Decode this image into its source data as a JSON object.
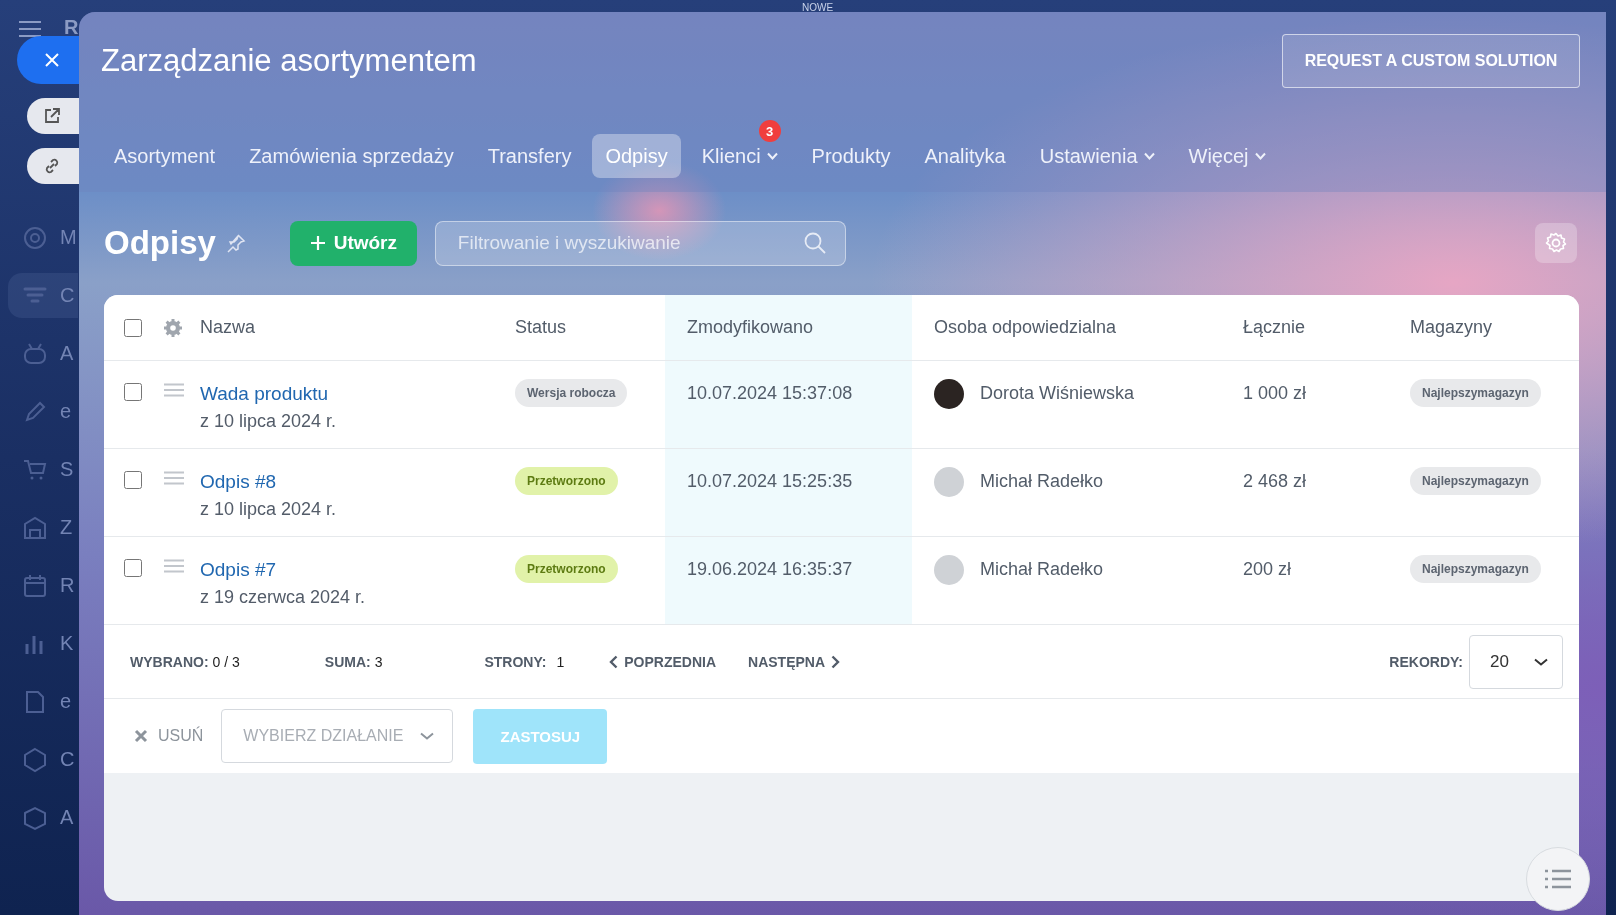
{
  "background": {
    "app_letter": "R",
    "top_label": "NOWE",
    "sidebar": [
      {
        "label": "M",
        "selected": false
      },
      {
        "label": "C",
        "selected": true
      },
      {
        "label": "A",
        "selected": false
      },
      {
        "label": "e",
        "selected": false
      },
      {
        "label": "S",
        "selected": false
      },
      {
        "label": "Z",
        "selected": false
      },
      {
        "label": "R",
        "selected": false
      },
      {
        "label": "K",
        "selected": false
      },
      {
        "label": "e",
        "selected": false
      },
      {
        "label": "C",
        "selected": false
      },
      {
        "label": "A",
        "selected": false
      }
    ]
  },
  "window": {
    "title": "Zarządzanie asortymentem",
    "request_button": "REQUEST A CUSTOM SOLUTION"
  },
  "tabs": [
    {
      "label": "Asortyment",
      "selected": false,
      "dropdown": false
    },
    {
      "label": "Zamówienia sprzedaży",
      "selected": false,
      "dropdown": false
    },
    {
      "label": "Transfery",
      "selected": false,
      "dropdown": false
    },
    {
      "label": "Odpisy",
      "selected": true,
      "dropdown": false
    },
    {
      "label": "Klienci",
      "selected": false,
      "dropdown": true,
      "badge": "3"
    },
    {
      "label": "Produkty",
      "selected": false,
      "dropdown": false
    },
    {
      "label": "Analityka",
      "selected": false,
      "dropdown": false
    },
    {
      "label": "Ustawienia",
      "selected": false,
      "dropdown": true
    },
    {
      "label": "Więcej",
      "selected": false,
      "dropdown": true
    }
  ],
  "page": {
    "title": "Odpisy",
    "create_button": "Utwórz",
    "search": {
      "placeholder": "Filtrowanie i wyszukiwanie"
    }
  },
  "table": {
    "select_all_checked": false,
    "columns": [
      {
        "label": "Nazwa",
        "highlighted": false
      },
      {
        "label": "Status",
        "highlighted": false
      },
      {
        "label": "Zmodyfikowano",
        "highlighted": true
      },
      {
        "label": "Osoba odpowiedzialna",
        "highlighted": false
      },
      {
        "label": "Łącznie",
        "highlighted": false
      },
      {
        "label": "Magazyny",
        "highlighted": false
      }
    ],
    "rows": [
      {
        "checked": false,
        "name": "Wada produktu",
        "date": "z 10 lipca 2024 r.",
        "status": {
          "label": "Wersja robocza",
          "kind": "draft"
        },
        "modified": "10.07.2024 15:37:08",
        "person": "Dorota Wiśniewska",
        "total": "1 000 zł",
        "warehouse": "Najlepszymagazyn"
      },
      {
        "checked": false,
        "name": "Odpis #8",
        "date": "z 10 lipca 2024 r.",
        "status": {
          "label": "Przetworzono",
          "kind": "processed"
        },
        "modified": "10.07.2024 15:25:35",
        "person": "Michał Radełko",
        "total": "2 468 zł",
        "warehouse": "Najlepszymagazyn"
      },
      {
        "checked": false,
        "name": "Odpis #7",
        "date": "z 19 czerwca 2024 r.",
        "status": {
          "label": "Przetworzono",
          "kind": "processed"
        },
        "modified": "19.06.2024 16:35:37",
        "person": "Michał Radełko",
        "total": "200 zł",
        "warehouse": "Najlepszymagazyn"
      }
    ]
  },
  "footer": {
    "selected_label": "WYBRANO:",
    "selected_value": "0 / 3",
    "sum_label": "SUMA:",
    "sum_value": "3",
    "pages_label": "STRONY:",
    "pages_value": "1",
    "prev": "POPRZEDNIA",
    "next": "NASTĘPNA",
    "records_label": "REKORDY:",
    "records_value": "20"
  },
  "actions": {
    "delete": "USUŃ",
    "action_placeholder": "WYBIERZ DZIAŁANIE",
    "apply": {
      "label": "ZASTOSUJ",
      "disabled": true
    }
  }
}
